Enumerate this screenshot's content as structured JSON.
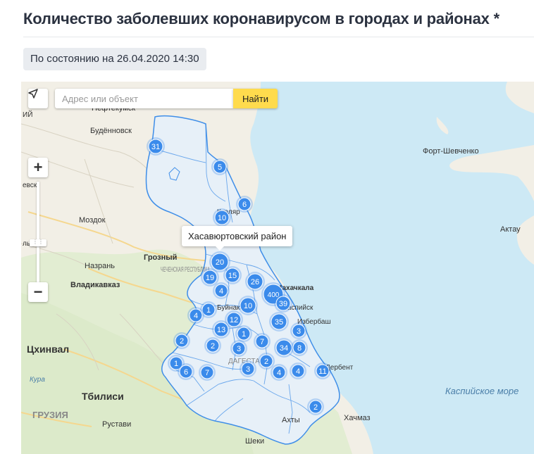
{
  "header": {
    "title": "Количество заболевших коронавирусом в городах и районах *",
    "status_date": "По состоянию на 26.04.2020 14:30"
  },
  "map_controls": {
    "search_placeholder": "Адрес или объект",
    "find_label": "Найти",
    "zoom_in": "+",
    "zoom_out": "−",
    "geolocate_icon": "arrow-icon"
  },
  "tooltip": "Хасавюртовский район",
  "map_labels": {
    "budennovsk": "Будённовск",
    "neftekumsk": "Нефтекумск",
    "mozdok": "Моздок",
    "groznyy": "Грозный",
    "nazran": "Назрань",
    "vladikavkaz": "Владикавказ",
    "chechnya": "ЧЕЧЕНСКАЯ РЕСПУБЛИКА",
    "tskhinval": "Цхинвал",
    "tbilisi": "Тбилиси",
    "georgia": "ГРУЗИЯ",
    "rustavi": "Рустави",
    "sheki": "Шеки",
    "akhty": "Ахты",
    "khachmaz": "Хачмаз",
    "fort": "Форт-Шевченко",
    "aktau": "Актау",
    "caspian": "Каспийское море",
    "kizlyar": "Кизляр",
    "buynaksk": "Буйнакск",
    "makhachkala": "Махачкала",
    "kaspiysk": "Каспийск",
    "izberbash": "Избербаш",
    "derbent": "Дербент",
    "kura": "Кура",
    "dagestan": "ДАГЕСТАН",
    "edge_1": "ИЙ",
    "edge_2": "евск",
    "edge_3": "лы"
  },
  "markers": [
    {
      "id": "m1",
      "value": "31"
    },
    {
      "id": "m2",
      "value": "5"
    },
    {
      "id": "m3",
      "value": "6"
    },
    {
      "id": "m4",
      "value": "10"
    },
    {
      "id": "m5",
      "value": "20"
    },
    {
      "id": "m6",
      "value": "19"
    },
    {
      "id": "m7",
      "value": "15"
    },
    {
      "id": "m8",
      "value": "26"
    },
    {
      "id": "m9",
      "value": "400"
    },
    {
      "id": "m10",
      "value": "39"
    },
    {
      "id": "m11",
      "value": "4"
    },
    {
      "id": "m12",
      "value": "10"
    },
    {
      "id": "m13",
      "value": "1"
    },
    {
      "id": "m14",
      "value": "4"
    },
    {
      "id": "m15",
      "value": "12"
    },
    {
      "id": "m16",
      "value": "13"
    },
    {
      "id": "m17",
      "value": "35"
    },
    {
      "id": "m18",
      "value": "1"
    },
    {
      "id": "m19",
      "value": "3"
    },
    {
      "id": "m20",
      "value": "2"
    },
    {
      "id": "m21",
      "value": "2"
    },
    {
      "id": "m22",
      "value": "3"
    },
    {
      "id": "m23",
      "value": "7"
    },
    {
      "id": "m24",
      "value": "34"
    },
    {
      "id": "m25",
      "value": "8"
    },
    {
      "id": "m26",
      "value": "1"
    },
    {
      "id": "m27",
      "value": "6"
    },
    {
      "id": "m28",
      "value": "7"
    },
    {
      "id": "m29",
      "value": "3"
    },
    {
      "id": "m30",
      "value": "2"
    },
    {
      "id": "m31",
      "value": "4"
    },
    {
      "id": "m32",
      "value": "4"
    },
    {
      "id": "m33",
      "value": "11"
    },
    {
      "id": "m34",
      "value": "2"
    }
  ],
  "colors": {
    "sea": "#cde9f5",
    "land": "#f2efe6",
    "hills": "#e2edd2",
    "region_fill": "#e7f0f8",
    "region_border": "#3f8ee8",
    "marker": "#3b8beb",
    "search_button": "#ffdb4d"
  }
}
